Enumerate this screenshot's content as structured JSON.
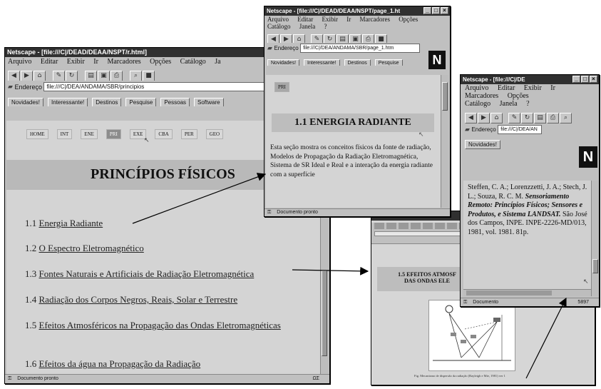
{
  "win_main": {
    "title": "Netscape - [file:///C|/DEAD/DEAA/NSPT/r.html]",
    "menu": [
      "Arquivo",
      "Editar",
      "Exibir",
      "Ir",
      "Marcadores",
      "Opções",
      "Catálogo",
      "Ja"
    ],
    "address_label": "Endereço",
    "address_value": "file:///C|/DEA/ANDAMA/SBR/principios",
    "dir_buttons": [
      "Novidades!",
      "Interessante!",
      "Destinos",
      "Pesquise",
      "Pessoas",
      "Software"
    ],
    "nav_tabs": [
      "HOME",
      "INT",
      "ENE",
      "PRI",
      "EXE",
      "CBA",
      "PER",
      "GEO"
    ],
    "page_heading": "PRINCÍPIOS FÍSICOS",
    "toc": [
      {
        "num": "1.1",
        "text": "Energia Radiante"
      },
      {
        "num": "1.2",
        "text": "O Espectro Eletromagnético"
      },
      {
        "num": "1.3",
        "text": "Fontes Naturais e Artificiais de Radiação Eletromagnética"
      },
      {
        "num": "1.4",
        "text": "Radiação dos Corpos Negros, Reais, Solar e Terrestre"
      },
      {
        "num": "1.5",
        "text": "Efeitos Atmosféricos na Propagação das Ondas Eletromagnéticas"
      },
      {
        "num": "1.6",
        "text": "Efeitos da água na Propagação da Radiação"
      }
    ],
    "status": "Documento pronto",
    "status_right": "ΩΣ"
  },
  "win_energy": {
    "title": "Netscape - [file:///C|/DEAD/DEAA/NSPT/page_1.ht",
    "menu1": [
      "Arquivo",
      "Editar",
      "Exibir",
      "Ir",
      "Marcadores",
      "Opções"
    ],
    "menu2": [
      "Catálogo",
      "Janela",
      "?"
    ],
    "address_label": "Endereço",
    "address_value": "file:///C|/DEA/ANDAMA/SBR/page_1.htm",
    "dir_buttons": [
      "Novidades!",
      "Interessante!",
      "Destinos",
      "Pesquise"
    ],
    "tab": "PRI",
    "heading": "1.1 ENERGIA RADIANTE",
    "body": "Esta seção mostra os conceitos físicos da fonte de radiação, Modelos de Propagação da Radiação Eletromagnética, Sistema de SR Ideal e Real e a interação da energia radiante com a superfície",
    "status": "Documento pronto"
  },
  "win_ref": {
    "title": "Netscape - [file:///C|/DE",
    "menu1": [
      "Arquivo",
      "Editar",
      "Exibir",
      "Ir"
    ],
    "menu2": [
      "Marcadores",
      "Opções"
    ],
    "menu3": [
      "Catálogo",
      "Janela",
      "?"
    ],
    "address_label": "Endereço",
    "address_value": "file:///C|/DEA/AN",
    "dir_button": "Novidades!",
    "reference_authors": "Steffen, C. A.; Lorenzzetti, J. A.; Stech, J. L.; Souza, R. C. M.",
    "reference_italic": "Sensoriamento Remoto: Princípios Físicos; Sensores e Produtos, e Sistema LANDSAT.",
    "reference_rest": "São José dos Campos, INPE. INPE-2226-MD/013, 1981, vol. 1981. 81p.",
    "status": "Documento",
    "status_right": "5897"
  },
  "win_atmos": {
    "title_text": "Netscape - file:///C|/DEAD/DEAA/NSPT",
    "heading_line1": "1.5 EFEITOS ATMOSF",
    "heading_line2": "DAS ONDAS ELE",
    "caption": "Fig. Mecanismo de dispersão da radiação (Rayleigh e Mie, 1981) ver 1"
  }
}
